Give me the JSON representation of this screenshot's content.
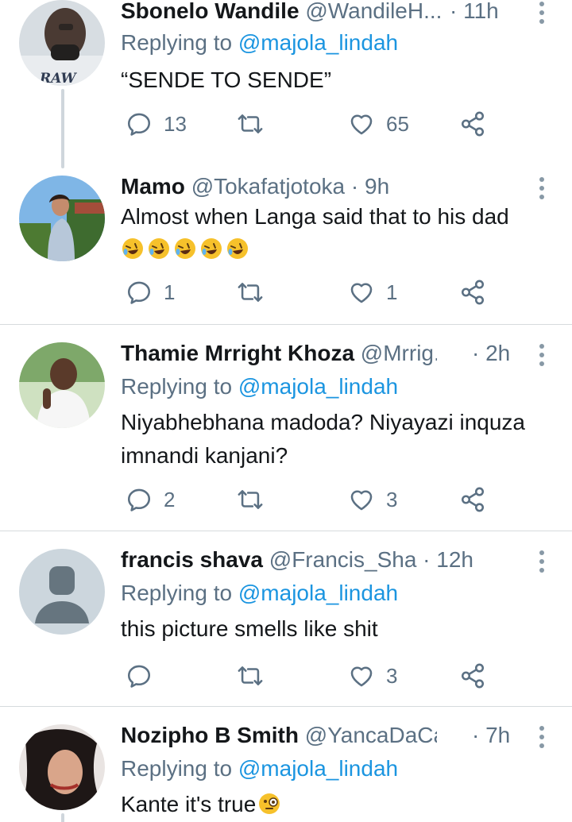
{
  "tweets": [
    {
      "name": "Sbonelo Wandile",
      "handle": "@WandileH...",
      "dot": "·",
      "time": "11h",
      "replying_label": "Replying to",
      "replying_to": "@majola_lindah",
      "text": "“SENDE TO SENDE”",
      "replies": "13",
      "retweets": "",
      "likes": "65"
    },
    {
      "name": "Mamo",
      "handle": "@Tokafatjotoka",
      "dot": "·",
      "time": "9h",
      "text": "Almost when Langa said that to his dad",
      "emoji_line": "🤣🤣🤣🤣🤣",
      "replies": "1",
      "retweets": "",
      "likes": "1"
    },
    {
      "name": "Thamie Mrright Khoza",
      "handle": "@Mrrig...",
      "dot": "·",
      "time": "2h",
      "replying_label": "Replying to",
      "replying_to": "@majola_lindah",
      "text_line1": "Niyabhebhana madoda? Niyayazi inquza",
      "text_line2": "imnandi kanjani?",
      "replies": "2",
      "retweets": "",
      "likes": "3"
    },
    {
      "name": "francis shava",
      "handle": "@Francis_Sha",
      "dot": "·",
      "time": "12h",
      "replying_label": "Replying to",
      "replying_to": "@majola_lindah",
      "text": "this picture smells like shit",
      "replies": "",
      "retweets": "",
      "likes": "3"
    },
    {
      "name": "Nozipho B Smith",
      "handle": "@YancaDaCa...",
      "dot": "·",
      "time": "7h",
      "replying_label": "Replying to",
      "replying_to": "@majola_lindah",
      "text": "Kante it's true",
      "text_emoji": "🧐"
    }
  ],
  "avatar_text": "RAW",
  "icons": {
    "reply": "reply-icon",
    "retweet": "retweet-icon",
    "like": "heart-icon",
    "share": "share-icon",
    "more": "more-vertical-icon"
  },
  "colors": {
    "text": "#14171a",
    "secondary": "#5b7083",
    "link": "#1b95e0",
    "divider": "#d6dadd"
  }
}
